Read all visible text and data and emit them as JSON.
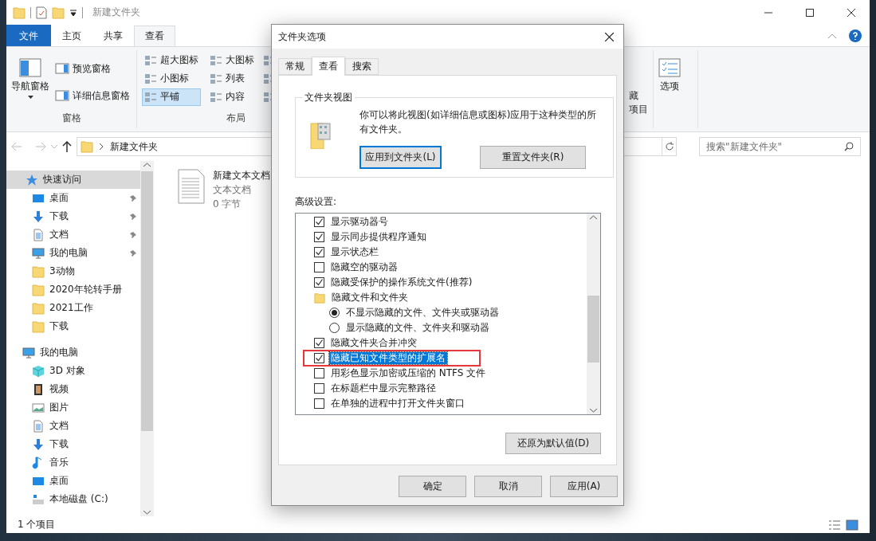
{
  "explorer": {
    "title": "新建文件夹",
    "ribbon_tabs": [
      {
        "label": "文件",
        "kind": "file",
        "selected": false
      },
      {
        "label": "主页",
        "kind": "tab",
        "selected": false
      },
      {
        "label": "共享",
        "kind": "tab",
        "selected": false
      },
      {
        "label": "查看",
        "kind": "tab",
        "selected": true
      }
    ],
    "panes_group": {
      "label": "窗格",
      "nav_pane": "导航窗格",
      "buttons": [
        "预览窗格",
        "详细信息窗格"
      ]
    },
    "layout_group": {
      "label": "布局",
      "options": [
        {
          "label": "超大图标",
          "selected": false
        },
        {
          "label": "大图标",
          "selected": false
        },
        {
          "label": "小图标",
          "selected": false
        },
        {
          "label": "列表",
          "selected": false
        },
        {
          "label": "平铺",
          "selected": true
        },
        {
          "label": "内容",
          "selected": false
        }
      ]
    },
    "hidden_group": {
      "lines": [
        "藏",
        "项目"
      ]
    },
    "options_group": {
      "label": "选项"
    },
    "address": {
      "path": "新建文件夹"
    },
    "search": {
      "placeholder": "搜索\"新建文件夹\""
    },
    "sidebar": [
      {
        "label": "快速访问",
        "kind": "star",
        "selected": true,
        "children": [
          {
            "label": "桌面",
            "kind": "desktop",
            "pinned": true
          },
          {
            "label": "下载",
            "kind": "download",
            "pinned": true
          },
          {
            "label": "文档",
            "kind": "document",
            "pinned": true
          },
          {
            "label": "我的电脑",
            "kind": "computer",
            "pinned": true
          },
          {
            "label": "3动物",
            "kind": "folder",
            "pinned": false
          },
          {
            "label": "2020年轮转手册",
            "kind": "folder",
            "pinned": false
          },
          {
            "label": "2021工作",
            "kind": "folder",
            "pinned": false
          },
          {
            "label": "下载",
            "kind": "folder",
            "pinned": false
          }
        ]
      },
      {
        "label": "我的电脑",
        "kind": "computer",
        "selected": false,
        "children": [
          {
            "label": "3D 对象",
            "kind": "cube",
            "pinned": false
          },
          {
            "label": "视频",
            "kind": "video",
            "pinned": false
          },
          {
            "label": "图片",
            "kind": "picture",
            "pinned": false
          },
          {
            "label": "文档",
            "kind": "document",
            "pinned": false
          },
          {
            "label": "下载",
            "kind": "download",
            "pinned": false
          },
          {
            "label": "音乐",
            "kind": "music",
            "pinned": false
          },
          {
            "label": "桌面",
            "kind": "desktop",
            "pinned": false
          },
          {
            "label": "本地磁盘 (C:)",
            "kind": "drive",
            "pinned": false
          }
        ]
      }
    ],
    "files": [
      {
        "name": "新建文本文档",
        "type": "文本文档",
        "size": "0 字节"
      }
    ],
    "status_bar": {
      "count": "1 个项目"
    }
  },
  "dialog": {
    "title": "文件夹选项",
    "tabs": [
      {
        "label": "常规",
        "selected": false
      },
      {
        "label": "查看",
        "selected": true
      },
      {
        "label": "搜索",
        "selected": false
      }
    ],
    "folder_views": {
      "legend": "文件夹视图",
      "description": "你可以将此视图(如详细信息或图标)应用于这种类型的所有文件夹。",
      "buttons": [
        {
          "label": "应用到文件夹(L)",
          "focused": true
        },
        {
          "label": "重置文件夹(R)",
          "focused": false
        }
      ]
    },
    "advanced": {
      "label": "高级设置:",
      "items": [
        {
          "kind": "checkbox",
          "label": "显示驱动器号",
          "checked": true,
          "selected": false,
          "annotated": false
        },
        {
          "kind": "checkbox",
          "label": "显示同步提供程序通知",
          "checked": true,
          "selected": false,
          "annotated": false
        },
        {
          "kind": "checkbox",
          "label": "显示状态栏",
          "checked": true,
          "selected": false,
          "annotated": false
        },
        {
          "kind": "checkbox",
          "label": "隐藏空的驱动器",
          "checked": false,
          "selected": false,
          "annotated": false
        },
        {
          "kind": "checkbox",
          "label": "隐藏受保护的操作系统文件(推荐)",
          "checked": true,
          "selected": false,
          "annotated": false
        },
        {
          "kind": "folder",
          "label": "隐藏文件和文件夹",
          "children": [
            {
              "kind": "radio",
              "label": "不显示隐藏的文件、文件夹或驱动器",
              "selected": true
            },
            {
              "kind": "radio",
              "label": "显示隐藏的文件、文件夹和驱动器",
              "selected": false
            }
          ]
        },
        {
          "kind": "checkbox",
          "label": "隐藏文件夹合并冲突",
          "checked": true,
          "selected": false,
          "annotated": false
        },
        {
          "kind": "checkbox",
          "label": "隐藏已知文件类型的扩展名",
          "checked": true,
          "selected": true,
          "annotated": true
        },
        {
          "kind": "checkbox",
          "label": "用彩色显示加密或压缩的 NTFS 文件",
          "checked": false,
          "selected": false,
          "annotated": false
        },
        {
          "kind": "checkbox",
          "label": "在标题栏中显示完整路径",
          "checked": false,
          "selected": false,
          "annotated": false
        },
        {
          "kind": "checkbox",
          "label": "在单独的进程中打开文件夹窗口",
          "checked": false,
          "selected": false,
          "annotated": false
        }
      ],
      "restore_button": "还原为默认值(D)"
    },
    "buttons": [
      "确定",
      "取消",
      "应用(A)"
    ]
  }
}
